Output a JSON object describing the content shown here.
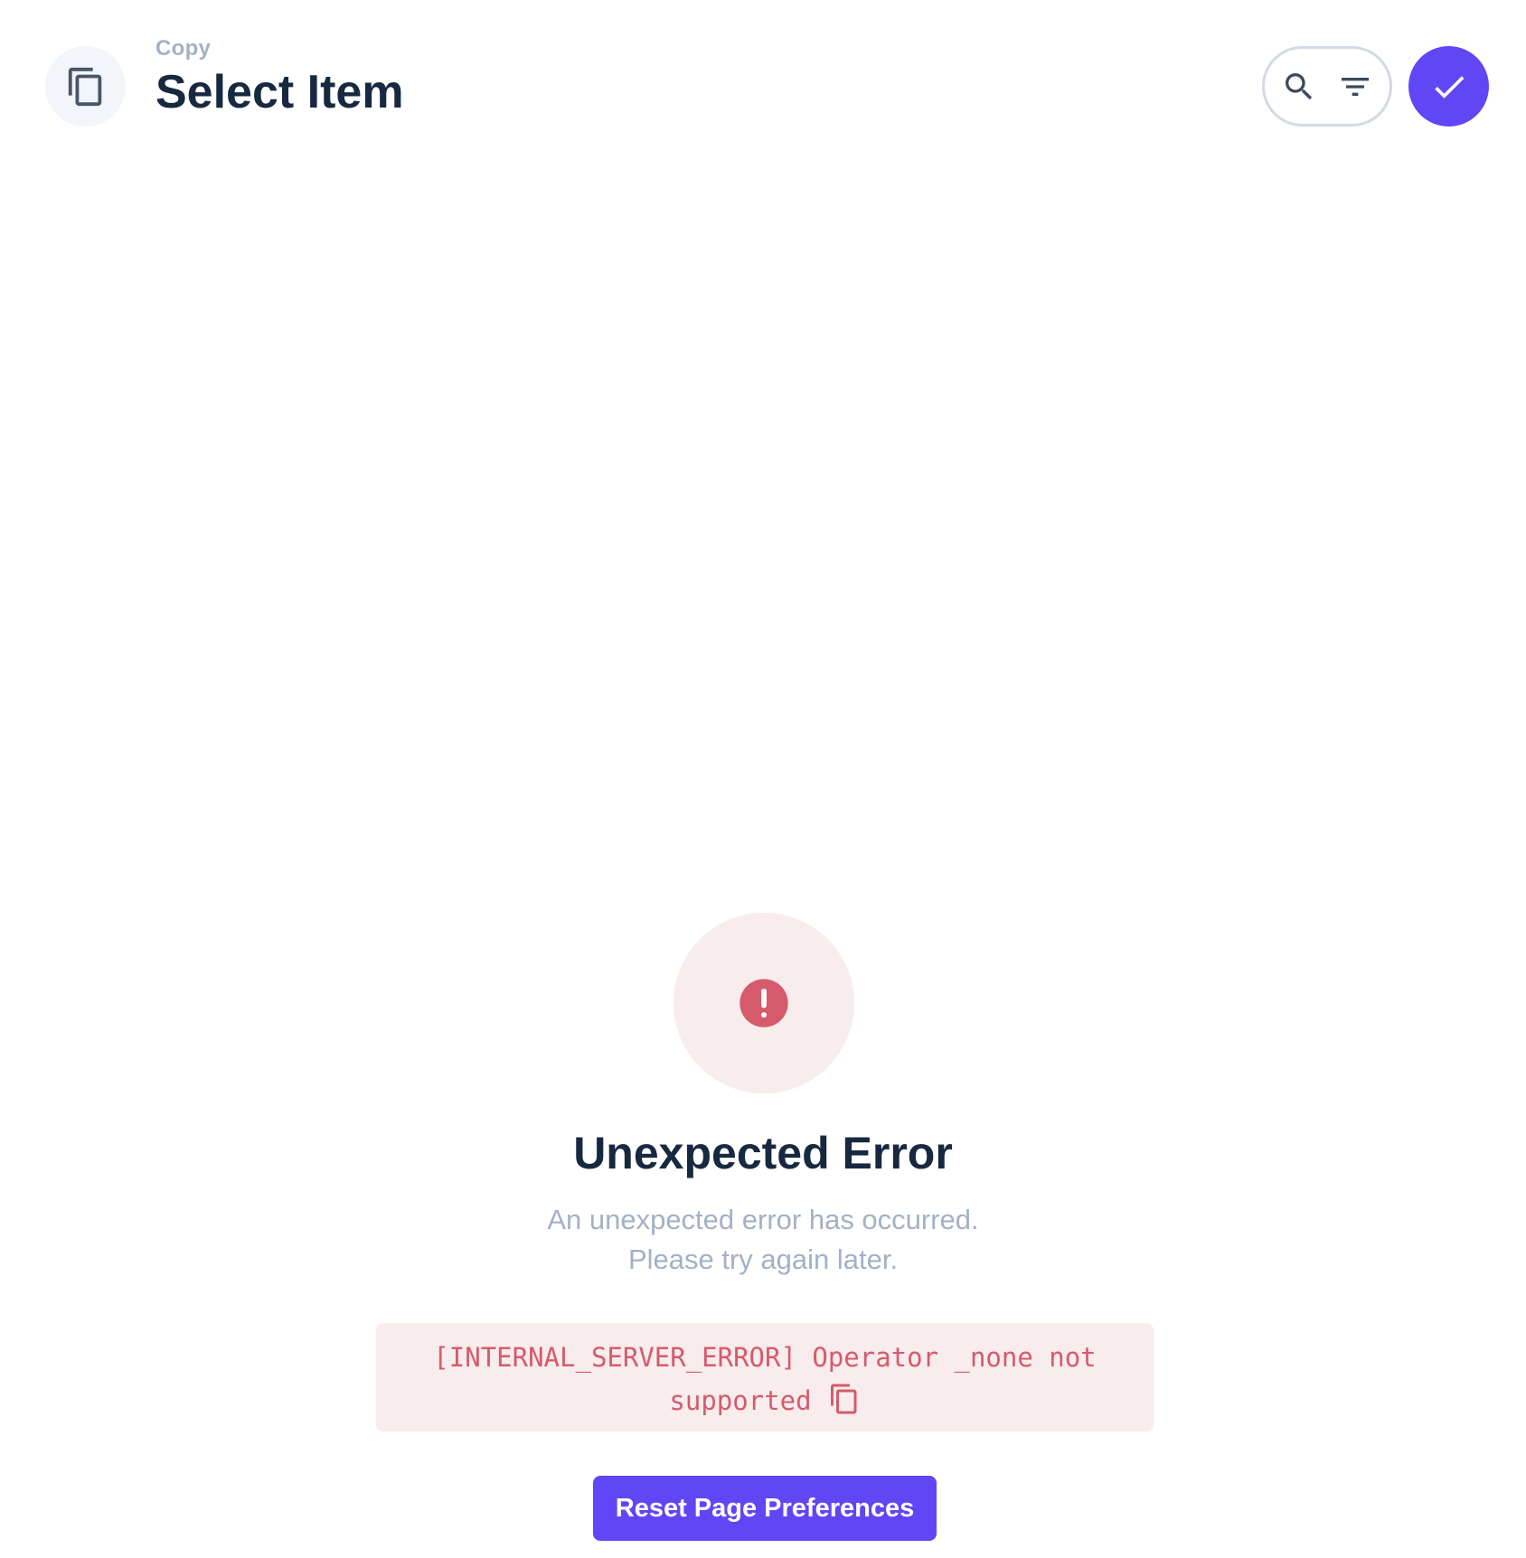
{
  "header": {
    "breadcrumb": "Copy",
    "title": "Select Item",
    "icon": "copy-icon",
    "search_icon": "search-icon",
    "filter_icon": "filter-icon",
    "confirm_icon": "check-icon"
  },
  "error": {
    "icon": "alert-circle-icon",
    "title": "Unexpected Error",
    "message_line1": "An unexpected error has occurred.",
    "message_line2": "Please try again later.",
    "code": "[INTERNAL_SERVER_ERROR] Operator _none not supported",
    "copy_icon": "copy-icon",
    "reset_label": "Reset Page Preferences"
  },
  "colors": {
    "accent": "#6146f5",
    "title_text": "#172940",
    "muted_text": "#a3b1c6",
    "error_red": "#d55b6c",
    "error_bg": "#f8eced"
  }
}
